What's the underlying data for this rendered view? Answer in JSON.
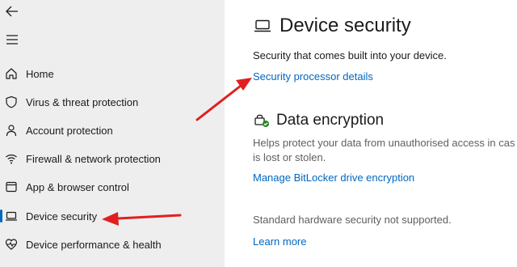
{
  "sidebar": {
    "items": [
      {
        "id": "home",
        "label": "Home",
        "icon": "home-icon"
      },
      {
        "id": "virus",
        "label": "Virus & threat protection",
        "icon": "shield-icon"
      },
      {
        "id": "account",
        "label": "Account protection",
        "icon": "person-icon"
      },
      {
        "id": "firewall",
        "label": "Firewall & network protection",
        "icon": "wifi-icon"
      },
      {
        "id": "app",
        "label": "App & browser control",
        "icon": "app-window-icon"
      },
      {
        "id": "device",
        "label": "Device security",
        "icon": "laptop-icon",
        "active": true
      },
      {
        "id": "performance",
        "label": "Device performance & health",
        "icon": "heart-pulse-icon"
      }
    ]
  },
  "main": {
    "title": "Device security",
    "subtitle": "Security that comes built into your device.",
    "processor_link": "Security processor details",
    "encryption": {
      "title": "Data encryption",
      "description_line1": "Helps protect your data from unauthorised access in cas",
      "description_line2": "is lost or stolen.",
      "link": "Manage BitLocker drive encryption"
    },
    "hardware_status": "Standard hardware security not supported.",
    "learn_more": "Learn more"
  },
  "colors": {
    "accent": "#0067c0",
    "annotation": "#e02020",
    "sidebar_bg": "#eeeeee"
  }
}
